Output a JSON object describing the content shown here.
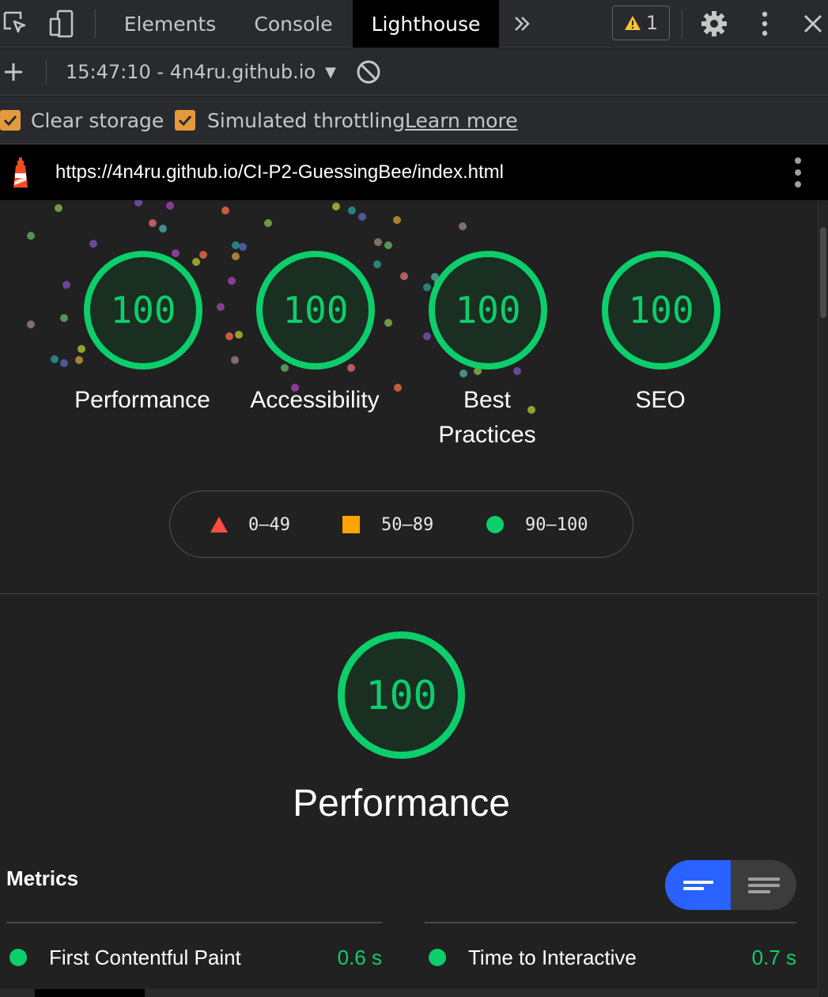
{
  "tabs": [
    {
      "label": "Elements",
      "active": false
    },
    {
      "label": "Console",
      "active": false
    },
    {
      "label": "Lighthouse",
      "active": true
    }
  ],
  "warnings": {
    "count": "1",
    "icon": "warning-triangle-icon"
  },
  "toolbar": {
    "report_label": "15:47:10 - 4n4ru.github.io"
  },
  "settings": {
    "clear_storage": {
      "label": "Clear storage",
      "checked": true
    },
    "simulated_throttling": {
      "label": "Simulated throttling",
      "checked": true
    },
    "learn_more": "Learn more"
  },
  "url": "https://4n4ru.github.io/CI-P2-GuessingBee/index.html",
  "scores": [
    {
      "score": "100",
      "label": "Performance"
    },
    {
      "score": "100",
      "label": "Accessibility"
    },
    {
      "score": "100",
      "label": "Best Practices"
    },
    {
      "score": "100",
      "label": "SEO"
    }
  ],
  "legend": [
    {
      "range": "0–49",
      "shape": "triangle",
      "color": "#ff4e42"
    },
    {
      "range": "50–89",
      "shape": "square",
      "color": "#ffa400"
    },
    {
      "range": "90–100",
      "shape": "circle",
      "color": "#0cce6b"
    }
  ],
  "category": {
    "score": "100",
    "title": "Performance"
  },
  "metrics": {
    "heading": "Metrics",
    "items": [
      {
        "name": "First Contentful Paint",
        "value": "0.6 s",
        "status": "pass"
      },
      {
        "name": "Time to Interactive",
        "value": "0.7 s",
        "status": "pass"
      }
    ]
  },
  "colors": {
    "pass": "#0cce6b",
    "average": "#ffa400",
    "fail": "#ff4e42",
    "accent": "#2962ff",
    "checkbox": "#e39a3c"
  }
}
